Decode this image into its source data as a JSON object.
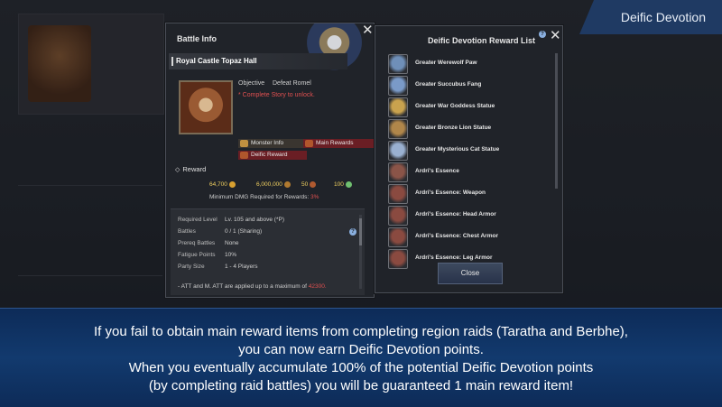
{
  "tag": "Deific Devotion",
  "battle_info": {
    "title": "Battle Info",
    "location": "Royal Castle Topaz Hall",
    "objective_label": "Objective",
    "objective_value": "Defeat Romel",
    "unlock_text": "* Complete Story to unlock.",
    "buttons": {
      "monster_info": "Monster Info",
      "main_rewards": "Main Rewards",
      "deific_reward": "Deific Reward"
    },
    "reward_label": "Reward",
    "reward_values": [
      "64,700",
      "6,000,000",
      "50",
      "100"
    ],
    "min_dmg_text": "Minimum DMG Required for Rewards:",
    "min_dmg_value": "3%",
    "details": [
      {
        "label": "Required Level",
        "value": "Lv. 105 and above (*P)"
      },
      {
        "label": "Battles",
        "value": "0 / 1 (Sharing)"
      },
      {
        "label": "Prereq Battles",
        "value": "None"
      },
      {
        "label": "Fatigue Points",
        "value": "10%"
      },
      {
        "label": "Party Size",
        "value": "1 - 4 Players"
      }
    ],
    "note_text": "- ATT and M. ATT are applied up to a maximum of",
    "note_value": "42300."
  },
  "reward_list": {
    "title": "Deific Devotion Reward List",
    "items": [
      {
        "name": "Greater Werewolf Paw",
        "icon": "werewolf-paw-icon",
        "color": "#6f8fb8"
      },
      {
        "name": "Greater Succubus Fang",
        "icon": "succubus-fang-icon",
        "color": "#7a9ac8"
      },
      {
        "name": "Greater War Goddess Statue",
        "icon": "goddess-statue-icon",
        "color": "#c9a24e"
      },
      {
        "name": "Greater Bronze Lion Statue",
        "icon": "lion-statue-icon",
        "color": "#b0864a"
      },
      {
        "name": "Greater Mysterious Cat Statue",
        "icon": "cat-statue-icon",
        "color": "#9ab0d0"
      },
      {
        "name": "Ardri's Essence",
        "icon": "essence-icon",
        "color": "#8a5448"
      },
      {
        "name": "Ardri's Essence: Weapon",
        "icon": "essence-weapon-icon",
        "color": "#8a4a40"
      },
      {
        "name": "Ardri's Essence: Head Armor",
        "icon": "essence-head-icon",
        "color": "#8a4a40"
      },
      {
        "name": "Ardri's Essence: Chest Armor",
        "icon": "essence-chest-icon",
        "color": "#8a4a40"
      },
      {
        "name": "Ardri's Essence: Leg Armor",
        "icon": "essence-leg-icon",
        "color": "#8a4a40"
      }
    ],
    "close_label": "Close"
  },
  "caption_lines": [
    "If you fail to obtain main reward items from completing region raids (Taratha and Berbhe),",
    "you can now earn Deific Devotion points.",
    "When you eventually accumulate 100% of the potential Deific Devotion points",
    "(by completing raid battles) you will be guaranteed 1 main reward item!"
  ]
}
